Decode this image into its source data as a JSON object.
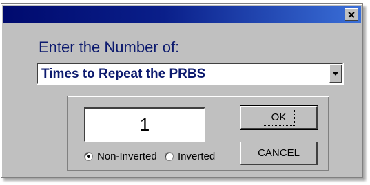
{
  "dialog": {
    "prompt_label": "Enter the Number of:",
    "combo": {
      "selected": "Times to Repeat the PRBS"
    },
    "number_value": "1",
    "radio": {
      "non_inverted": "Non-Inverted",
      "inverted": "Inverted",
      "selected": "non_inverted"
    },
    "buttons": {
      "ok": "OK",
      "cancel": "CANCEL"
    }
  },
  "colors": {
    "title_bar_start": "#000a6e",
    "title_bar_end": "#3a6fd8",
    "label_text": "#0c1a6e",
    "face": "#c0c0c0"
  },
  "icons": {
    "close": "close-icon",
    "dropdown": "chevron-down-icon"
  }
}
